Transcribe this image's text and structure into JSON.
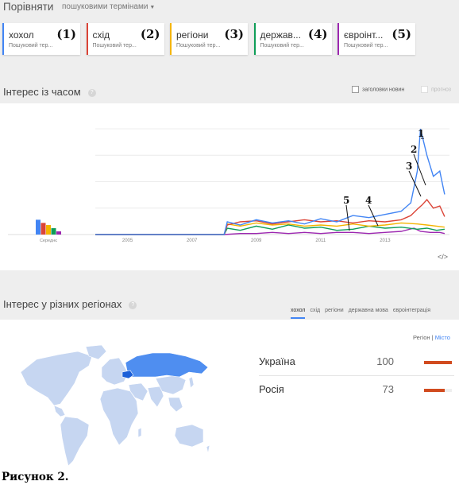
{
  "header": {
    "compare_title": "Порівняти",
    "compare_mode": "пошуковими термінами"
  },
  "terms": [
    {
      "label": "хохол",
      "kind": "Пошуковий тер...",
      "num": "(1)",
      "color": "#4285f4"
    },
    {
      "label": "схід",
      "kind": "Пошуковий тер...",
      "num": "(2)",
      "color": "#db4437"
    },
    {
      "label": "регіони",
      "kind": "Пошуковий тер...",
      "num": "(3)",
      "color": "#f4b400"
    },
    {
      "label": "держав...",
      "kind": "Пошуковий тер...",
      "num": "(4)",
      "color": "#0f9d58"
    },
    {
      "label": "євроінт...",
      "kind": "Пошуковий тер...",
      "num": "(5)",
      "color": "#9c27b0"
    }
  ],
  "interest_over_time": {
    "title": "Інтерес із часом",
    "news_headlines_label": "заголовки новин",
    "forecast_label": "прогноз"
  },
  "chart_data": {
    "type": "line",
    "title": "",
    "xlabel": "",
    "ylabel": "",
    "x_tick_labels": [
      "2005",
      "2007",
      "2009",
      "2011",
      "2013"
    ],
    "average_label": "Середнє",
    "average_bars": [
      {
        "series": "хохол",
        "value": 14
      },
      {
        "series": "схід",
        "value": 11
      },
      {
        "series": "регіони",
        "value": 9
      },
      {
        "series": "державна мова",
        "value": 6
      },
      {
        "series": "євроінтеграція",
        "value": 3
      }
    ],
    "ylim": [
      0,
      100
    ],
    "x_range": [
      2004,
      2015
    ],
    "grid": true,
    "annotations": [
      {
        "label": "1",
        "series": 0
      },
      {
        "label": "2",
        "series": 1
      },
      {
        "label": "3",
        "series": 2
      },
      {
        "label": "4",
        "series": 3
      },
      {
        "label": "5",
        "series": 4
      }
    ],
    "series": [
      {
        "name": "хохол",
        "color": "#4285f4",
        "x": [
          2004,
          2008,
          2008.1,
          2008.5,
          2009,
          2009.5,
          2010,
          2010.5,
          2011,
          2011.5,
          2012,
          2012.5,
          2013,
          2013.5,
          2013.8,
          2014.0,
          2014.1,
          2014.3,
          2014.5,
          2014.7,
          2014.85
        ],
        "y": [
          0,
          0,
          12,
          9,
          14,
          11,
          13,
          10,
          15,
          12,
          18,
          16,
          19,
          22,
          30,
          60,
          100,
          75,
          55,
          60,
          38
        ]
      },
      {
        "name": "схід",
        "color": "#db4437",
        "x": [
          2004,
          2008,
          2008.1,
          2008.5,
          2009,
          2009.5,
          2010,
          2010.5,
          2011,
          2011.5,
          2012,
          2012.5,
          2013,
          2013.5,
          2013.8,
          2014.0,
          2014.15,
          2014.3,
          2014.5,
          2014.7,
          2014.85
        ],
        "y": [
          0,
          0,
          9,
          12,
          13,
          10,
          12,
          14,
          12,
          13,
          11,
          13,
          12,
          14,
          18,
          24,
          28,
          33,
          25,
          27,
          17
        ]
      },
      {
        "name": "регіони",
        "color": "#f4b400",
        "x": [
          2004,
          2008,
          2008.1,
          2008.5,
          2009,
          2009.5,
          2010,
          2010.5,
          2011,
          2011.5,
          2012,
          2012.5,
          2013,
          2013.5,
          2014.0,
          2014.3,
          2014.6,
          2014.85
        ],
        "y": [
          0,
          0,
          10,
          8,
          11,
          9,
          10,
          8,
          9,
          8,
          10,
          8,
          9,
          11,
          10,
          9,
          8,
          7
        ]
      },
      {
        "name": "державна мова",
        "color": "#0f9d58",
        "x": [
          2004,
          2008,
          2008.1,
          2008.5,
          2009,
          2009.5,
          2010,
          2010.5,
          2011,
          2011.5,
          2012,
          2012.5,
          2013,
          2013.5,
          2014.0,
          2014.3,
          2014.6,
          2014.85
        ],
        "y": [
          0,
          0,
          6,
          4,
          8,
          5,
          9,
          6,
          7,
          4,
          5,
          8,
          6,
          7,
          5,
          6,
          4,
          5
        ]
      },
      {
        "name": "євроінтеграція",
        "color": "#9c27b0",
        "x": [
          2004,
          2008,
          2008.5,
          2009,
          2009.5,
          2010,
          2010.5,
          2011,
          2011.5,
          2012,
          2012.5,
          2013,
          2013.5,
          2013.9,
          2014.1,
          2014.4,
          2014.7,
          2014.85
        ],
        "y": [
          0,
          0,
          1,
          1,
          2,
          1,
          2,
          1,
          2,
          2,
          1,
          2,
          3,
          6,
          3,
          2,
          2,
          1
        ]
      }
    ]
  },
  "regions": {
    "title": "Інтерес у різних регіонах",
    "tabs": [
      "хохол",
      "схід",
      "регіони",
      "державна мова",
      "євроінтеграція"
    ],
    "toggle_region": "Регіон",
    "toggle_city": "Місто",
    "rows": [
      {
        "country": "Україна",
        "value": "100",
        "fraction": 1.0
      },
      {
        "country": "Росія",
        "value": "73",
        "fraction": 0.73
      }
    ]
  },
  "caption": "Рисунок 2."
}
